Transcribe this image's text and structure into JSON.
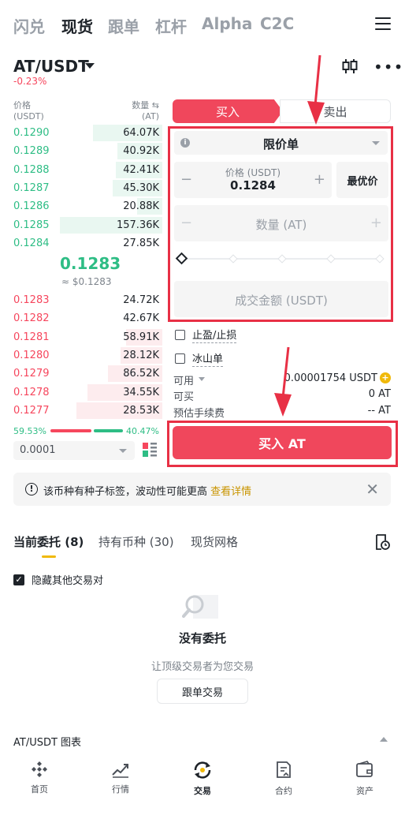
{
  "top_nav": {
    "tabs": [
      "闪兑",
      "现货",
      "跟单",
      "杠杆",
      "Alpha",
      "C2C"
    ],
    "active": "现货"
  },
  "pair": {
    "symbol": "AT/USDT",
    "change": "-0.23%"
  },
  "order_book": {
    "price_header": "价格",
    "price_unit": "(USDT)",
    "qty_header": "数量",
    "qty_unit": "(AT)",
    "asks": [
      {
        "price": "0.1290",
        "qty": "64.07K",
        "depth": 0.42
      },
      {
        "price": "0.1289",
        "qty": "40.92K",
        "depth": 0.27
      },
      {
        "price": "0.1288",
        "qty": "42.41K",
        "depth": 0.28
      },
      {
        "price": "0.1287",
        "qty": "45.30K",
        "depth": 0.3
      },
      {
        "price": "0.1286",
        "qty": "20.88K",
        "depth": 0.15
      },
      {
        "price": "0.1285",
        "qty": "157.36K",
        "depth": 0.62
      },
      {
        "price": "0.1284",
        "qty": "27.85K",
        "depth": 0.0
      }
    ],
    "mid_price": "0.1283",
    "mid_usd": "≈ $0.1283",
    "bids": [
      {
        "price": "0.1283",
        "qty": "24.72K",
        "depth": 0.0
      },
      {
        "price": "0.1282",
        "qty": "42.67K",
        "depth": 0.0
      },
      {
        "price": "0.1281",
        "qty": "58.91K",
        "depth": 0.22
      },
      {
        "price": "0.1280",
        "qty": "28.12K",
        "depth": 0.25
      },
      {
        "price": "0.1279",
        "qty": "86.52K",
        "depth": 0.33
      },
      {
        "price": "0.1278",
        "qty": "34.55K",
        "depth": 0.45
      },
      {
        "price": "0.1277",
        "qty": "28.53K",
        "depth": 0.52
      }
    ],
    "buy_ratio": "59.53%",
    "sell_ratio": "40.47%",
    "precision": "0.0001"
  },
  "form": {
    "tab_buy": "买入",
    "tab_sell": "卖出",
    "order_type": "限价单",
    "price_label": "价格 (USDT)",
    "price_value": "0.1284",
    "best_price": "最优价",
    "qty_placeholder": "数量 (AT)",
    "total_placeholder": "成交金额 (USDT)",
    "tp_sl": "止盈/止损",
    "iceberg": "冰山单",
    "available_label": "可用",
    "available_value": "0.00001754 USDT",
    "can_buy_label": "可买",
    "can_buy_value": "0 AT",
    "fee_label": "预估手续费",
    "fee_value": "-- AT",
    "buy_button": "买入 AT"
  },
  "notice": {
    "text": "该币种有种子标签，波动性可能更高",
    "link": "查看详情"
  },
  "orders": {
    "tabs": [
      "当前委托 (8)",
      "持有币种 (30)",
      "现货网格"
    ],
    "hide_other": "隐藏其他交易对",
    "empty_title": "没有委托",
    "empty_sub": "让顶级交易者为您交易",
    "copy_trade_button": "跟单交易"
  },
  "chart_bar": {
    "label": "AT/USDT 图表"
  },
  "bottom_nav": {
    "items": [
      "首页",
      "行情",
      "交易",
      "合约",
      "资产"
    ],
    "active": "交易"
  },
  "colors": {
    "buy_red": "#f0475c",
    "green": "#2ebd85",
    "red": "#f6465d",
    "accent_yellow": "#f0b90b",
    "annotation_red": "#e83045"
  }
}
